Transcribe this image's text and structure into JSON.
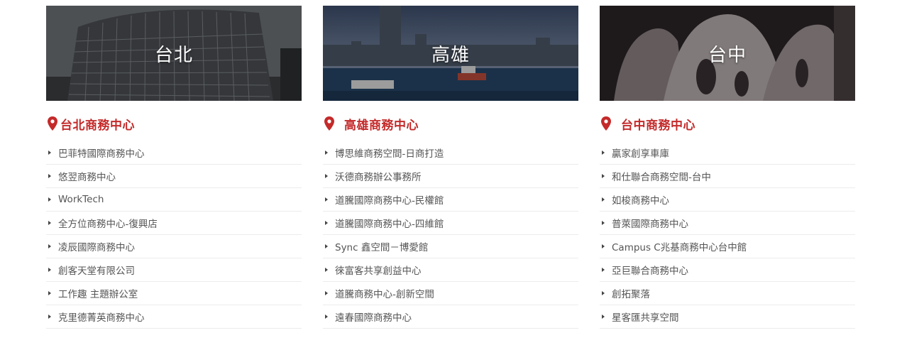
{
  "columns": [
    {
      "city": "台北",
      "title": "台北商務中心",
      "image_icon": "taipei-building-photo",
      "items": [
        "巴菲特國際商務中心",
        "悠翌商務中心",
        "WorkTech",
        "全方位商務中心-復興店",
        "凌辰國際商務中心",
        "創客天堂有限公司",
        "工作趣 主題辦公室",
        "克里德菁英商務中心"
      ]
    },
    {
      "city": "高雄",
      "title": "高雄商務中心",
      "image_icon": "kaohsiung-harbor-photo",
      "items": [
        "博思維商務空間-日商打造",
        "沃德商務辦公事務所",
        "道騰國際商務中心-民權館",
        "道騰國際商務中心-四維館",
        "Sync 鑫空間－博愛館",
        "徠富客共享創益中心",
        "道騰商務中心-創新空間",
        "遠春國際商務中心"
      ]
    },
    {
      "city": "台中",
      "title": "台中商務中心",
      "image_icon": "taichung-opera-house-photo",
      "items": [
        "贏家創享車庫",
        "和仕聯合商務空間-台中",
        "如梭商務中心",
        "普萊國際商務中心",
        "Campus C兆基商務中心台中館",
        "亞巨聯合商務中心",
        "創拓聚落",
        "星客匯共享空間"
      ]
    }
  ],
  "colors": {
    "accent": "#c42a2a",
    "text": "#555555",
    "divider": "#ececec"
  }
}
